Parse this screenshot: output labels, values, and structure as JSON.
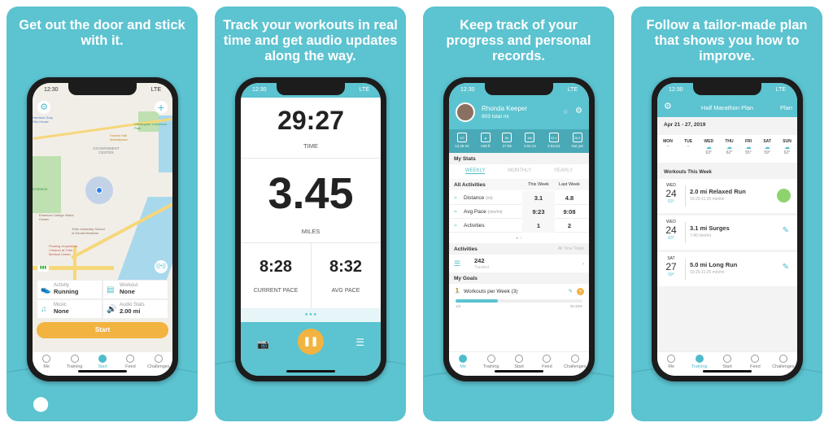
{
  "colors": {
    "teal": "#5cc3d0",
    "accent": "#4fbccb",
    "orange": "#f2b340",
    "green": "#8ed46e"
  },
  "status": {
    "time": "12:30",
    "signal": "LTE"
  },
  "tabs": [
    "Me",
    "Training",
    "Start",
    "Feed",
    "Challenges"
  ],
  "panel1": {
    "headline": "Get out the door and stick with it.",
    "map_labels": [
      "Harrison Gray Otis House",
      "Christopher Columbus Park",
      "Faneuil Hall Marketplace",
      "GOVERNMENT CENTER",
      "Common",
      "Emerson College Visitor Center",
      "Tufts University School of Dental Medicine",
      "Floating Hospital for Children at Tufts Medical Center"
    ],
    "info": [
      {
        "label": "Activity",
        "value": "Running",
        "icon": "shoe-icon"
      },
      {
        "label": "Workout",
        "value": "None",
        "icon": "clipboard-icon"
      },
      {
        "label": "Music",
        "value": "None",
        "icon": "music-icon"
      },
      {
        "label": "Audio Stats",
        "value": "2.00 mi",
        "icon": "speaker-icon"
      }
    ],
    "start": "Start"
  },
  "panel2": {
    "headline": "Track your workouts in real time and get audio updates along the way.",
    "time": "29:27",
    "time_label": "TIME",
    "distance": "3.45",
    "distance_label": "MILES",
    "current_pace": "8:28",
    "current_pace_label": "CURRENT PACE",
    "avg_pace": "8:32",
    "avg_pace_label": "AVG PACE"
  },
  "panel3": {
    "headline": "Keep track of your progress and personal records.",
    "name": "Rhonda Keeper",
    "total": "903 total mi",
    "records": [
      {
        "badge": "1/2",
        "value": "13.26 mi"
      },
      {
        "badge": "▲",
        "value": "648 ft"
      },
      {
        "badge": "5k",
        "value": "27:05"
      },
      {
        "badge": "10k",
        "value": "1:01:13"
      },
      {
        "badge": "13.1",
        "value": "2:04:24"
      },
      {
        "badge": "26.2",
        "value": "Not yet"
      }
    ],
    "my_stats": "My Stats",
    "periods": [
      "WEEKLY",
      "MONTHLY",
      "YEARLY"
    ],
    "filter": "All Activities",
    "this_week": "This Week",
    "last_week": "Last Week",
    "stats": [
      {
        "label": "Distance",
        "unit": "(mi)",
        "this": "3.1",
        "last": "4.8"
      },
      {
        "label": "Avg Pace",
        "unit": "(min/mi)",
        "this": "9:23",
        "last": "9:08"
      },
      {
        "label": "Activities",
        "unit": "",
        "this": "1",
        "last": "2"
      }
    ],
    "activities": "Activities",
    "all_time": "All Time Totals",
    "tracked_count": "242",
    "tracked": "Tracked",
    "goals": "My Goals",
    "goal": "Workouts per Week (3)",
    "goal_progress": 33.33,
    "goal_left": "1/3",
    "goal_right": "33.33%"
  },
  "panel4": {
    "headline": "Follow a tailor-made plan that shows you how to improve.",
    "title": "Half Marathon Plan",
    "plan": "Plan",
    "range": "Apr 21 - 27, 2019",
    "days": [
      {
        "d": "MON",
        "t": "–"
      },
      {
        "d": "TUE",
        "t": "–"
      },
      {
        "d": "WED",
        "t": "63°"
      },
      {
        "d": "THU",
        "t": "62°"
      },
      {
        "d": "FRI",
        "t": "55°"
      },
      {
        "d": "SAT",
        "t": "59°"
      },
      {
        "d": "SUN",
        "t": "62°"
      }
    ],
    "section": "Workouts This Week",
    "workouts": [
      {
        "dow": "WED",
        "day": "24",
        "temp": "63°",
        "title": "2.0 mi Relaxed Run",
        "pace": "10:25-11:25 min/mi",
        "done": true
      },
      {
        "dow": "WED",
        "day": "24",
        "temp": "63°",
        "title": "3.1 mi Surges",
        "pace": "7:40 min/mi",
        "done": false
      },
      {
        "dow": "SAT",
        "day": "27",
        "temp": "59°",
        "title": "5.0 mi Long Run",
        "pace": "10:25-11:25 min/mi",
        "done": false
      }
    ]
  }
}
